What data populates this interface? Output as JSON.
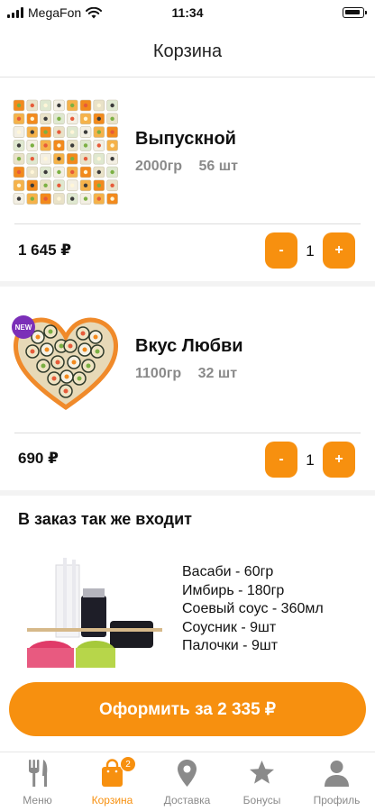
{
  "status_bar": {
    "carrier": "MegaFon",
    "time": "11:34"
  },
  "header": {
    "title": "Корзина"
  },
  "cart_items": [
    {
      "name": "Выпускной",
      "weight": "2000гр",
      "pieces": "56 шт",
      "price": "1 645 ₽",
      "quantity": "1",
      "minus_label": "-",
      "plus_label": "+",
      "badge": ""
    },
    {
      "name": "Вкус Любви",
      "weight": "1100гр",
      "pieces": "32 шт",
      "price": "690 ₽",
      "quantity": "1",
      "minus_label": "-",
      "plus_label": "+",
      "badge": "NEW"
    }
  ],
  "extras": {
    "title": "В заказ так же входит",
    "items": [
      "Васаби - 60гр",
      "Имбирь - 180гр",
      "Соевый соус - 360мл",
      "Соусник - 9шт",
      "Палочки - 9шт"
    ]
  },
  "checkout": {
    "label": "Оформить за 2 335 ₽"
  },
  "tab_bar": {
    "tabs": [
      {
        "label": "Меню",
        "icon": "fork-knife-icon"
      },
      {
        "label": "Корзина",
        "icon": "bag-icon",
        "badge": "2",
        "active": true
      },
      {
        "label": "Доставка",
        "icon": "location-pin-icon"
      },
      {
        "label": "Бонусы",
        "icon": "star-icon"
      },
      {
        "label": "Профиль",
        "icon": "person-icon"
      }
    ]
  },
  "colors": {
    "accent": "#f7900f",
    "inactive": "#8a8a8a",
    "new_badge": "#7b2fb8"
  }
}
